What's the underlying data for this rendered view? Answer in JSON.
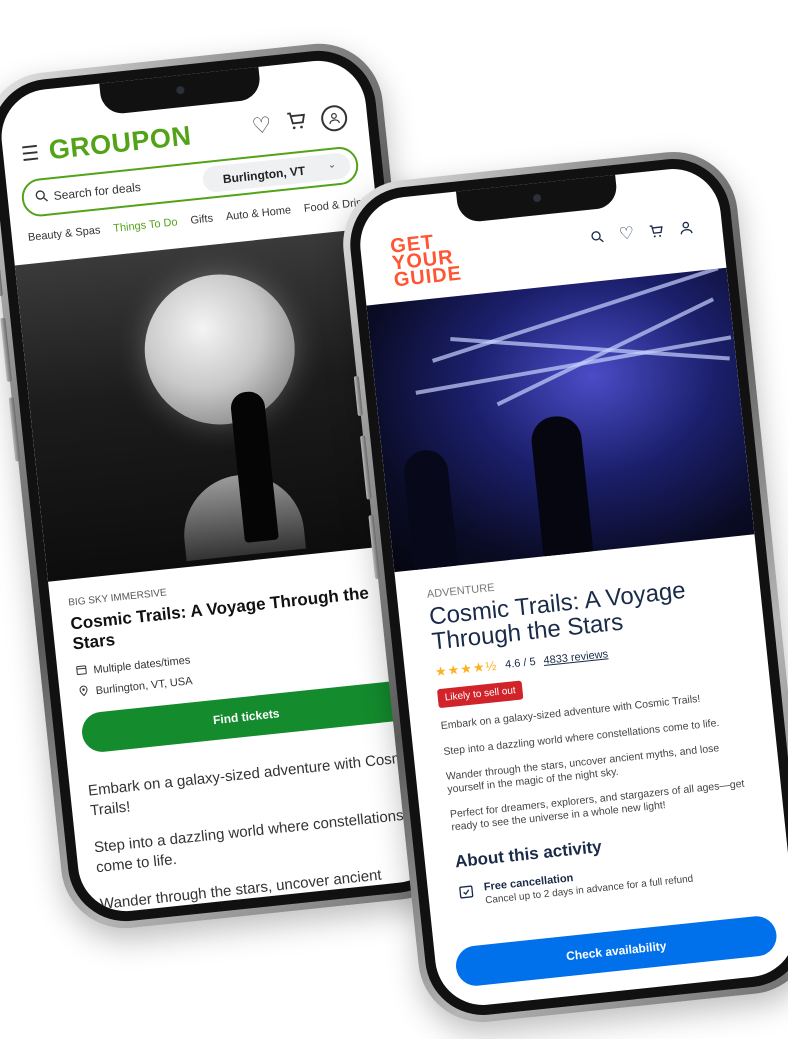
{
  "groupon": {
    "logo_text": "GROUPON",
    "brand_color": "#53a318",
    "menu_icon": "hamburger-menu-icon",
    "header_icons": [
      "heart-icon",
      "cart-icon",
      "user-icon"
    ],
    "search": {
      "placeholder": "Search for deals",
      "location": "Burlington, VT"
    },
    "nav": [
      {
        "label": "Beauty & Spas",
        "active": false
      },
      {
        "label": "Things To Do",
        "active": true
      },
      {
        "label": "Gifts",
        "active": false
      },
      {
        "label": "Auto & Home",
        "active": false
      },
      {
        "label": "Food & Drink",
        "active": false
      }
    ],
    "deal": {
      "vendor": "BIG SKY IMMERSIVE",
      "title": "Cosmic Trails: A Voyage Through the Stars",
      "dates": "Multiple dates/times",
      "location": "Burlington, VT, USA",
      "cta": "Find tickets",
      "cta_color": "#148b2d",
      "description": [
        "Embark on a galaxy-sized adventure with Cosmic Trails!",
        "Step into a dazzling world where constellations come to life.",
        "Wander through the stars, uncover ancient myths, and lose yourself in the magic of the night sky."
      ]
    }
  },
  "getyourguide": {
    "logo_lines": [
      "GET",
      "YOUR",
      "GUIDE"
    ],
    "brand_color": "#ff5533",
    "header_icons": [
      "search-icon",
      "heart-icon",
      "cart-icon",
      "profile-icon"
    ],
    "activity": {
      "category": "ADVENTURE",
      "title": "Cosmic Trails: A Voyage Through the Stars",
      "stars": "★★★★½",
      "rating": "4.6 / 5",
      "reviews": "4833 reviews",
      "badge": "Likely to sell out",
      "description": [
        "Embark on a galaxy-sized adventure with Cosmic Trails!",
        "Step into a dazzling world where constellations come to life.",
        "Wander through the stars, uncover ancient myths, and lose yourself in the magic of the night sky.",
        "Perfect for dreamers, explorers, and stargazers of all ages—get ready to see the universe in a whole new light!"
      ],
      "about_heading": "About this activity",
      "cancellation_title": "Free cancellation",
      "cancellation_text": "Cancel up to 2 days in advance for a full refund",
      "cta": "Check availability",
      "cta_color": "#0071eb"
    }
  }
}
